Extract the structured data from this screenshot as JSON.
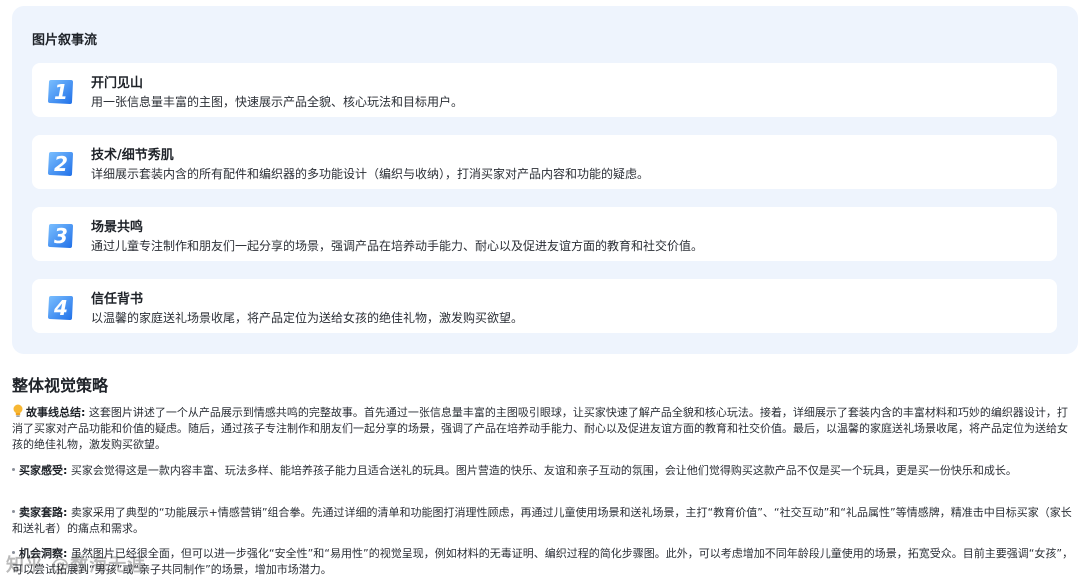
{
  "panel": {
    "title": "图片叙事流",
    "cards": [
      {
        "num": "1",
        "title": "开门见山",
        "desc": "用一张信息量丰富的主图，快速展示产品全貌、核心玩法和目标用户。"
      },
      {
        "num": "2",
        "title": "技术/细节秀肌",
        "desc": "详细展示套装内含的所有配件和编织器的多功能设计（编织与收纳），打消买家对产品内容和功能的疑虑。"
      },
      {
        "num": "3",
        "title": "场景共鸣",
        "desc": "通过儿童专注制作和朋友们一起分享的场景，强调产品在培养动手能力、耐心以及促进友谊方面的教育和社交价值。"
      },
      {
        "num": "4",
        "title": "信任背书",
        "desc": "以温馨的家庭送礼场景收尾，将产品定位为送给女孩的绝佳礼物，激发购买欲望。"
      }
    ]
  },
  "strategy": {
    "title": "整体视觉策略",
    "summary_label": "故事线总结:",
    "summary_text": " 这套图片讲述了一个从产品展示到情感共鸣的完整故事。首先通过一张信息量丰富的主图吸引眼球，让买家快速了解产品全貌和核心玩法。接着，详细展示了套装内含的丰富材料和巧妙的编织器设计，打消了买家对产品功能和价值的疑虑。随后，通过孩子专注制作和朋友们一起分享的场景，强调了产品在培养动手能力、耐心以及促进友谊方面的教育和社交价值。最后，以温馨的家庭送礼场景收尾，将产品定位为送给女孩的绝佳礼物，激发购买欲望。",
    "bullets": [
      {
        "label": "买家感受:",
        "text": " 买家会觉得这是一款内容丰富、玩法多样、能培养孩子能力且适合送礼的玩具。图片营造的快乐、友谊和亲子互动的氛围，会让他们觉得购买这款产品不仅是买一个玩具，更是买一份快乐和成长。"
      },
      {
        "label": "卖家套路:",
        "text": " 卖家采用了典型的“功能展示+情感营销”组合拳。先通过详细的清单和功能图打消理性顾虑，再通过儿童使用场景和送礼场景，主打“教育价值”、“社交互动”和“礼品属性”等情感牌，精准击中目标买家（家长和送礼者）的痛点和需求。"
      },
      {
        "label": "机会洞察:",
        "text": " 虽然图片已经很全面，但可以进一步强化“安全性”和“易用性”的视觉呈现，例如材料的无毒证明、编织过程的简化步骤图。此外，可以考虑增加不同年龄段儿童使用的场景，拓宽受众。目前主要强调“女孩”，可以尝试拓展到“男孩”或“亲子共同制作”的场景，增加市场潜力。"
      }
    ]
  },
  "watermark": "知乎 @数海无涯",
  "colors": {
    "panel_bg": "#eef4fd",
    "card_bg": "#ffffff",
    "icon_blue": "#2f86f6"
  }
}
